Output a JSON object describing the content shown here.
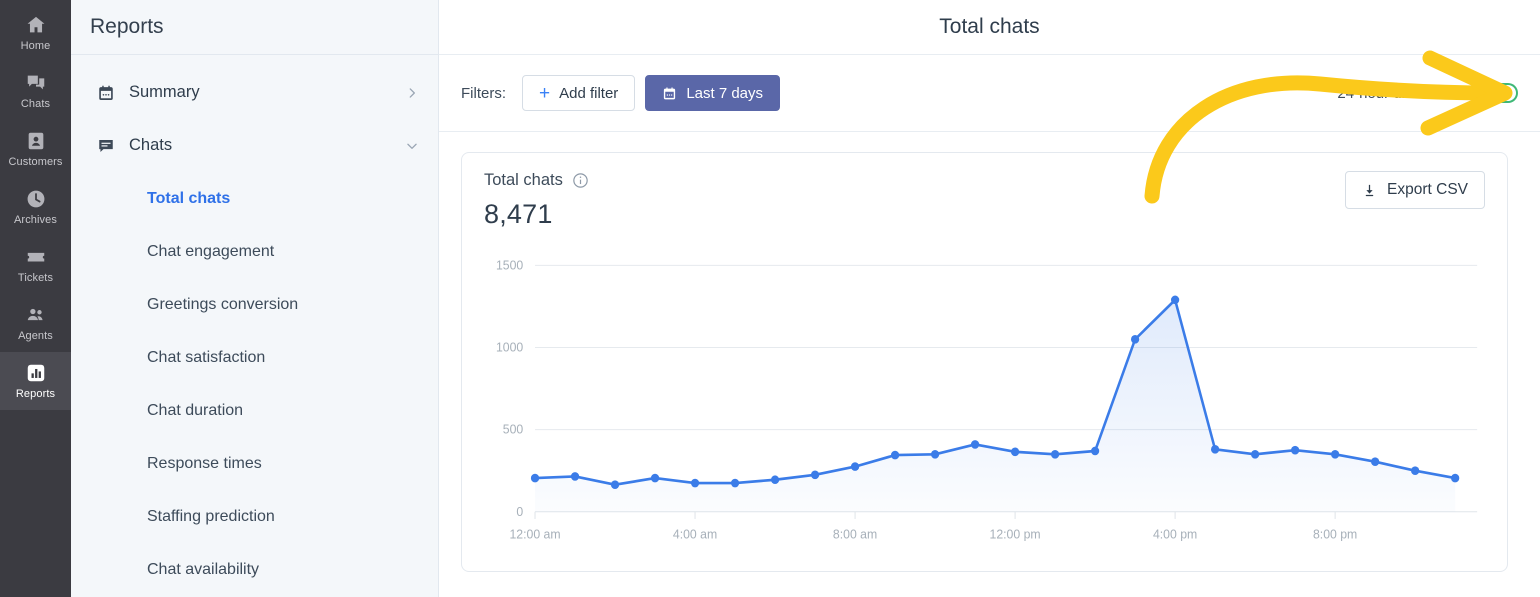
{
  "rail": {
    "items": [
      {
        "label": "Home",
        "icon": "home-icon",
        "active": false
      },
      {
        "label": "Chats",
        "icon": "chats-icon",
        "active": false
      },
      {
        "label": "Customers",
        "icon": "customers-icon",
        "active": false
      },
      {
        "label": "Archives",
        "icon": "archives-icon",
        "active": false
      },
      {
        "label": "Tickets",
        "icon": "tickets-icon",
        "active": false
      },
      {
        "label": "Agents",
        "icon": "agents-icon",
        "active": false
      },
      {
        "label": "Reports",
        "icon": "reports-icon",
        "active": true
      }
    ]
  },
  "panel": {
    "title": "Reports",
    "groups": [
      {
        "label": "Summary",
        "icon": "calendar-icon",
        "chevron": "chevron-right"
      },
      {
        "label": "Chats",
        "icon": "chat-bubble-icon",
        "chevron": "chevron-down"
      }
    ],
    "sub_items": [
      {
        "label": "Total chats",
        "active": true
      },
      {
        "label": "Chat engagement",
        "active": false
      },
      {
        "label": "Greetings conversion",
        "active": false
      },
      {
        "label": "Chat satisfaction",
        "active": false
      },
      {
        "label": "Chat duration",
        "active": false
      },
      {
        "label": "Response times",
        "active": false
      },
      {
        "label": "Staffing prediction",
        "active": false
      },
      {
        "label": "Chat availability",
        "active": false
      }
    ]
  },
  "header": {
    "title": "Total chats"
  },
  "filters": {
    "label": "Filters:",
    "add_filter_label": "Add filter",
    "date_range_label": "Last 7 days",
    "distribution_label": "24-hour distribution:",
    "distribution_on": "on"
  },
  "card": {
    "metric_label": "Total chats",
    "metric_value": "8,471",
    "export_label": "Export CSV"
  },
  "colors": {
    "accent_blue": "#3b7ce8",
    "active_link": "#2f71e8",
    "range_button": "#5a67a8",
    "toggle_on": "#3fb877",
    "annotation_arrow": "#fbc91b",
    "rail_bg": "#3b3b41",
    "panel_bg": "#f4f7fa"
  },
  "chart_data": {
    "type": "area",
    "title": "Total chats",
    "xlabel": "",
    "ylabel": "",
    "ylim": [
      0,
      1500
    ],
    "yticks": [
      0,
      500,
      1000,
      1500
    ],
    "grid": true,
    "legend": false,
    "x": [
      "12:00 am",
      "1:00 am",
      "2:00 am",
      "3:00 am",
      "4:00 am",
      "5:00 am",
      "6:00 am",
      "7:00 am",
      "8:00 am",
      "9:00 am",
      "10:00 am",
      "11:00 am",
      "12:00 pm",
      "1:00 pm",
      "2:00 pm",
      "3:00 pm",
      "4:00 pm",
      "5:00 pm",
      "6:00 pm",
      "7:00 pm",
      "8:00 pm",
      "9:00 pm",
      "10:00 pm",
      "11:00 pm"
    ],
    "xtick_labels": [
      "12:00 am",
      "4:00 am",
      "8:00 am",
      "12:00 pm",
      "4:00 pm",
      "8:00 pm"
    ],
    "xtick_indices": [
      0,
      4,
      8,
      12,
      16,
      20
    ],
    "values": [
      205,
      215,
      165,
      205,
      175,
      175,
      195,
      225,
      275,
      345,
      350,
      410,
      365,
      350,
      370,
      1050,
      1290,
      380,
      350,
      375,
      350,
      305,
      250,
      205
    ]
  }
}
